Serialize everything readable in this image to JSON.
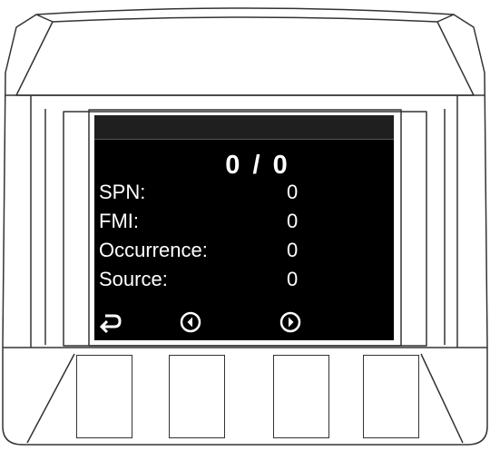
{
  "screen": {
    "counter": "0 / 0",
    "fields": [
      {
        "label": "SPN:",
        "value": "0"
      },
      {
        "label": "FMI:",
        "value": "0"
      },
      {
        "label": "Occurrence:",
        "value": "0"
      },
      {
        "label": "Source:",
        "value": "0"
      }
    ],
    "softkeys": [
      {
        "icon": "return-icon"
      },
      {
        "icon": "circle-arrow-left-icon"
      },
      {
        "icon": "circle-arrow-right-icon"
      }
    ]
  },
  "physical_buttons": [
    "button-1",
    "button-2",
    "button-3",
    "button-4"
  ]
}
